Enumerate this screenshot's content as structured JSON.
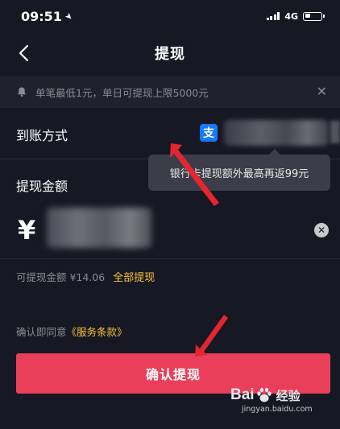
{
  "status_bar": {
    "time": "09:51",
    "network": "4G"
  },
  "nav": {
    "title": "提现"
  },
  "notice": {
    "text": "单笔最低1元，单日可提现上限5000元"
  },
  "method": {
    "label": "到账方式",
    "alipay_glyph": "支"
  },
  "tooltip": {
    "text": "银行卡提现额外最高再返99元"
  },
  "amount": {
    "label": "提现金额",
    "currency": "¥"
  },
  "available": {
    "text": "可提现金额 ¥14.06",
    "withdraw_all": "全部提现"
  },
  "agreement": {
    "prefix": "确认即同意",
    "terms": "《服务条款》"
  },
  "confirm_button": {
    "label": "确认提现"
  },
  "watermark": {
    "brand_a": "Bai",
    "brand_b": "经验",
    "url": "jingyan.baidu.com"
  },
  "colors": {
    "background": "#161823",
    "accent_red": "#ea3f5b",
    "link_yellow": "#f7c23b",
    "alipay_blue": "#1678ff"
  }
}
